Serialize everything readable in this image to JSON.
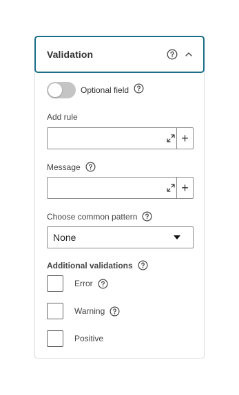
{
  "panel": {
    "title": "Validation",
    "expanded": true
  },
  "optional_field": {
    "label": "Optional field",
    "enabled": false
  },
  "add_rule": {
    "label": "Add rule",
    "value": "",
    "add_glyph": "+"
  },
  "message": {
    "label": "Message",
    "value": "",
    "add_glyph": "+"
  },
  "common_pattern": {
    "label": "Choose common pattern",
    "selected": "None"
  },
  "additional_validations": {
    "title": "Additional validations",
    "items": [
      {
        "label": "Error",
        "checked": false,
        "has_help": true
      },
      {
        "label": "Warning",
        "checked": false,
        "has_help": true
      },
      {
        "label": "Positive",
        "checked": false,
        "has_help": false
      }
    ]
  },
  "icons": {
    "help": "question-circle-icon",
    "collapse": "chevron-up-icon",
    "expand": "expand-arrows-icon",
    "dropdown": "caret-down-icon"
  },
  "colors": {
    "header_border": "#1a6e8a",
    "toggle_off": "#c4c4c4",
    "panel_border": "#dcdcdc"
  }
}
